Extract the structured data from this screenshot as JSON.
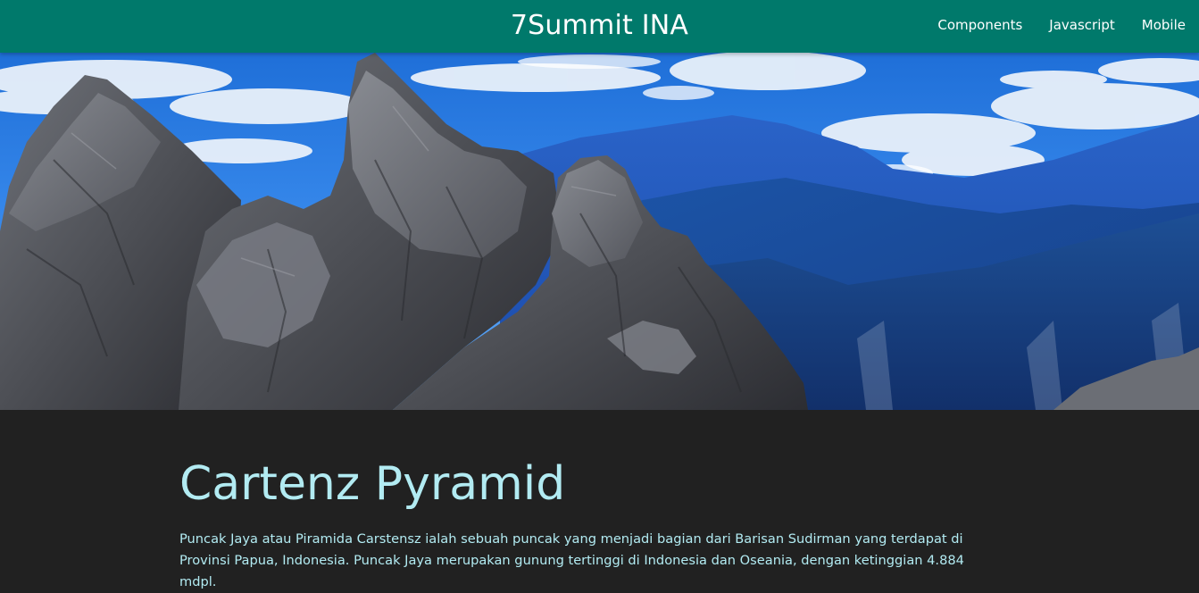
{
  "navbar": {
    "brand": "7Summit INA",
    "links": [
      {
        "label": "Components"
      },
      {
        "label": "Javascript"
      },
      {
        "label": "Mobile"
      }
    ],
    "color": "#00796b"
  },
  "hero": {
    "image": "mountain-summit-photo"
  },
  "main": {
    "title": "Cartenz Pyramid",
    "description": "Puncak Jaya atau Piramida Carstensz ialah sebuah puncak yang menjadi bagian dari Barisan Sudirman yang terdapat di Provinsi Papua, Indonesia. Puncak Jaya merupakan gunung tertinggi di Indonesia dan Oseania, dengan ketinggian 4.884 mdpl."
  },
  "colors": {
    "background": "#212121",
    "title_text": "#b2ebf2",
    "accent": "#00796b"
  }
}
